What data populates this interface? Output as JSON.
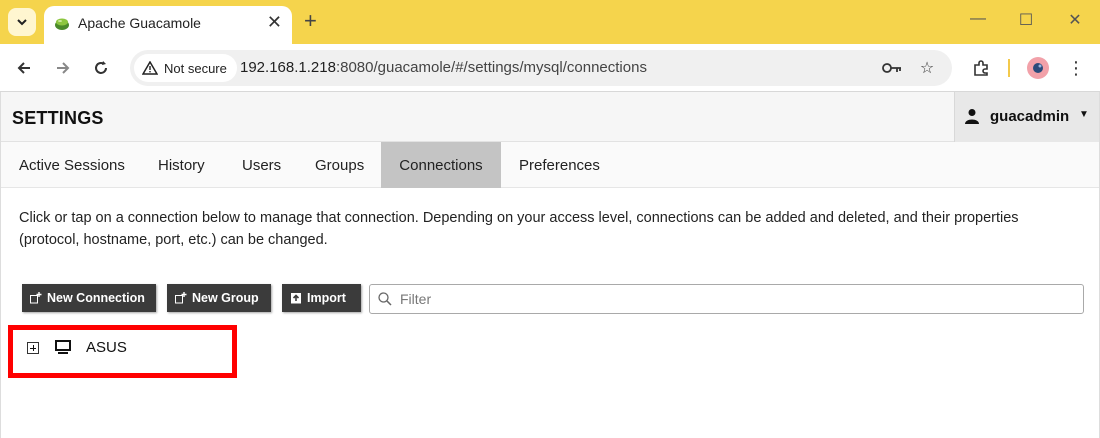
{
  "browser": {
    "tab_title": "Apache Guacamole",
    "new_tab_symbol": "+",
    "security_label": "Not secure",
    "url_host": "192.168.1.218",
    "url_rest": ":8080/guacamole/#/settings/mysql/connections"
  },
  "header": {
    "title": "SETTINGS",
    "username": "guacadmin"
  },
  "tabs": [
    {
      "label": "Active Sessions",
      "active": false
    },
    {
      "label": "History",
      "active": false
    },
    {
      "label": "Users",
      "active": false
    },
    {
      "label": "Groups",
      "active": false
    },
    {
      "label": "Connections",
      "active": true
    },
    {
      "label": "Preferences",
      "active": false
    }
  ],
  "description": "Click or tap on a connection below to manage that connection. Depending on your access level, connections can be added and deleted, and their properties (protocol, hostname, port, etc.) can be changed.",
  "actions": {
    "new_connection": "New Connection",
    "new_group": "New Group",
    "import": "Import"
  },
  "filter": {
    "placeholder": "Filter",
    "value": ""
  },
  "connections": [
    {
      "name": "ASUS",
      "icon": "monitor-icon"
    }
  ],
  "colors": {
    "tabstrip": "#f5d44c",
    "active_tab": "#c4c4c4",
    "action_button": "#3b3b3b",
    "highlight": "#ff0000"
  }
}
